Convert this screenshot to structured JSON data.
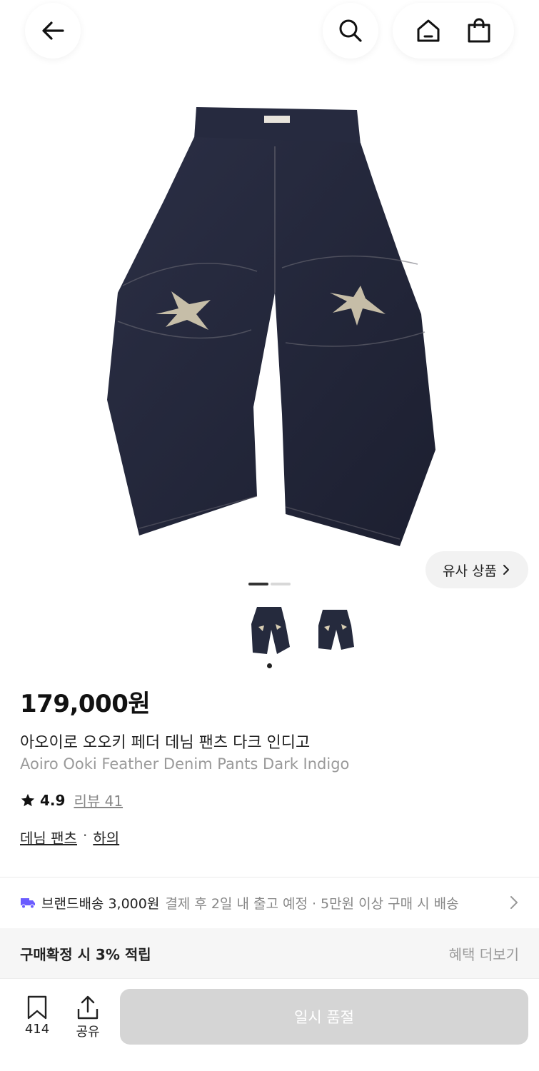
{
  "header": {
    "back_icon": "arrow-left-icon",
    "search_icon": "search-icon",
    "home_icon": "home-icon",
    "cart_icon": "shopping-bag-icon"
  },
  "gallery": {
    "similar_label": "유사 상품",
    "image_count": 2,
    "current_index": 1
  },
  "product": {
    "price": "179,000원",
    "name_ko": "아오이로 오오키 페더 데님 팬츠 다크 인디고",
    "name_en": "Aoiro Ooki Feather Denim Pants Dark Indigo",
    "rating": "4.9",
    "review_label": "리뷰 41",
    "category_1": "데님 팬츠",
    "category_sep": "·",
    "category_2": "하의"
  },
  "shipping": {
    "brand_label": "브랜드배송 3,000원",
    "info": "결제 후 2일 내 출고 예정 · 5만원 이상 구매 시 배송"
  },
  "benefit": {
    "title": "구매확정 시 3% 적립",
    "more": "혜택 더보기"
  },
  "bottom": {
    "wish_count": "414",
    "share_label": "공유",
    "soldout_label": "일시 품절"
  },
  "colors": {
    "denim": "#24273a",
    "accent_truck": "#6b5cff",
    "soldout_bg": "#d5d5d5"
  }
}
